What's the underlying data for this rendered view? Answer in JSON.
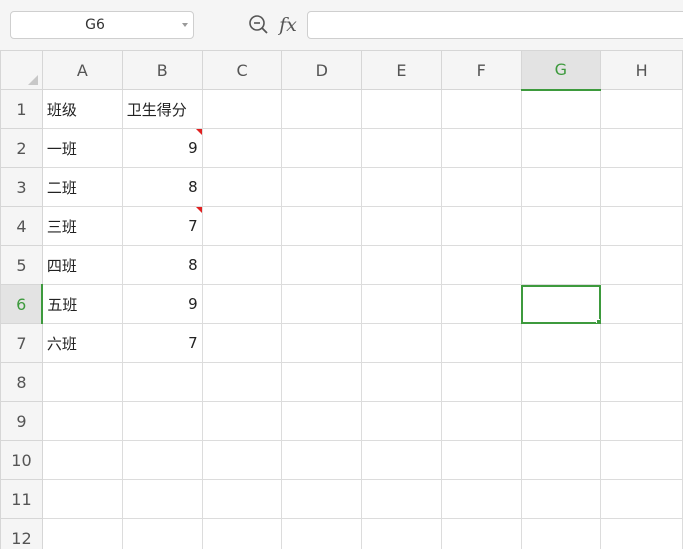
{
  "toolbar": {
    "name_box": "G6",
    "zoom_icon": "zoom-formula-icon",
    "fx_label": "fx",
    "formula_value": ""
  },
  "sheet": {
    "columns": [
      "A",
      "B",
      "C",
      "D",
      "E",
      "F",
      "G",
      "H"
    ],
    "active_column": "G",
    "active_row": 6,
    "selected_cell": "G6",
    "accent_color": "#3d9a3d",
    "comment_marker_color": "#e02020",
    "comment_marked_cells": [
      "B2",
      "B4"
    ],
    "rows": [
      {
        "num": "1",
        "A": "班级",
        "B": "卫生得分"
      },
      {
        "num": "2",
        "A": "一班",
        "B": "9"
      },
      {
        "num": "3",
        "A": "二班",
        "B": "8"
      },
      {
        "num": "4",
        "A": "三班",
        "B": "7"
      },
      {
        "num": "5",
        "A": "四班",
        "B": "8"
      },
      {
        "num": "6",
        "A": "五班",
        "B": "9"
      },
      {
        "num": "7",
        "A": "六班",
        "B": "7"
      },
      {
        "num": "8",
        "A": "",
        "B": ""
      },
      {
        "num": "9",
        "A": "",
        "B": ""
      },
      {
        "num": "10",
        "A": "",
        "B": ""
      },
      {
        "num": "11",
        "A": "",
        "B": ""
      },
      {
        "num": "12",
        "A": "",
        "B": ""
      }
    ]
  }
}
